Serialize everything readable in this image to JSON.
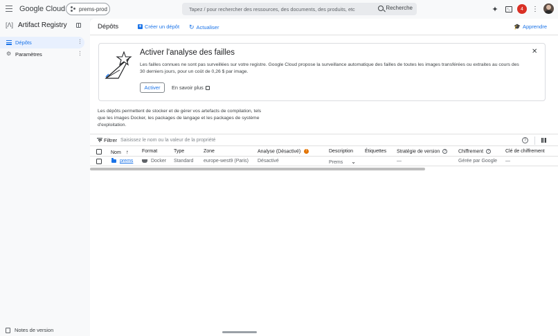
{
  "topbar": {
    "logo": "Google Cloud",
    "project": "prems-prod",
    "search_placeholder": "Tapez / pour rechercher des ressources, des documents, des produits, etc",
    "search_button": "Recherche",
    "notifications_count": "4"
  },
  "sidebar": {
    "product_title": "Artifact Registry",
    "items": [
      {
        "label": "Dépôts",
        "active": true
      },
      {
        "label": "Paramètres",
        "active": false
      }
    ],
    "footer": "Notes de version"
  },
  "header": {
    "title": "Dépôts",
    "create": "Créer un dépôt",
    "refresh": "Actualiser",
    "learn": "Apprendre"
  },
  "banner": {
    "title": "Activer l'analyse des failles",
    "text": "Les failles connues ne sont pas surveillées sur votre registre. Google Cloud propose la surveillance automatique des failles de toutes les images transférées ou extraites au cours des 30 derniers jours, pour un coût de 0,26 $ par image.",
    "activate": "Activer",
    "learn_more": "En savoir plus"
  },
  "description": "Les dépôts permettent de stocker et de gérer vos artefacts de compilation, tels que les images Docker, les packages de langage et les packages de système d'exploitation.",
  "filter": {
    "label": "Filtrer",
    "placeholder": "Saisissez le nom ou la valeur de la propriété"
  },
  "table": {
    "columns": [
      "Nom",
      "Format",
      "Type",
      "Zone",
      "Analyse (Désactivé)",
      "Description",
      "Étiquettes",
      "Stratégie de version",
      "Chiffrement",
      "Clé de chiffrement"
    ],
    "rows": [
      {
        "name": "prems",
        "format": "Docker",
        "type": "Standard",
        "zone": "europe-west9 (Paris)",
        "analyse": "Désactivé",
        "description": "Prems",
        "labels": "",
        "version_policy": "—",
        "encryption": "Gérée par Google",
        "key": "—"
      }
    ]
  }
}
